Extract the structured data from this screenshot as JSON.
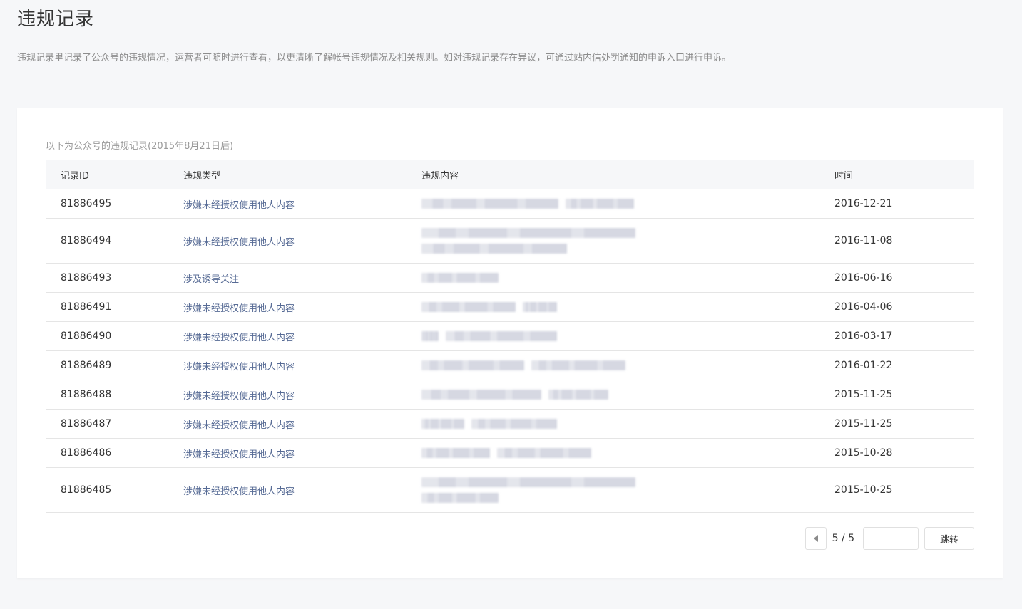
{
  "page": {
    "title": "违规记录",
    "description": "违规记录里记录了公众号的违规情况，运营者可随时进行查看，以更清晰了解帐号违规情况及相关规则。如对违规记录存在异议，可通过站内信处罚通知的申诉入口进行申诉。"
  },
  "card": {
    "caption": "以下为公众号的违规记录(2015年8月21日后)"
  },
  "table": {
    "headers": {
      "id": "记录ID",
      "type": "违规类型",
      "content": "违规内容",
      "time": "时间"
    },
    "rows": [
      {
        "id": "81886495",
        "type": "涉嫌未经授权使用他人内容",
        "time": "2016-12-21"
      },
      {
        "id": "81886494",
        "type": "涉嫌未经授权使用他人内容",
        "time": "2016-11-08"
      },
      {
        "id": "81886493",
        "type": "涉及诱导关注",
        "time": "2016-06-16"
      },
      {
        "id": "81886491",
        "type": "涉嫌未经授权使用他人内容",
        "time": "2016-04-06"
      },
      {
        "id": "81886490",
        "type": "涉嫌未经授权使用他人内容",
        "time": "2016-03-17"
      },
      {
        "id": "81886489",
        "type": "涉嫌未经授权使用他人内容",
        "time": "2016-01-22"
      },
      {
        "id": "81886488",
        "type": "涉嫌未经授权使用他人内容",
        "time": "2015-11-25"
      },
      {
        "id": "81886487",
        "type": "涉嫌未经授权使用他人内容",
        "time": "2015-11-25"
      },
      {
        "id": "81886486",
        "type": "涉嫌未经授权使用他人内容",
        "time": "2015-10-28"
      },
      {
        "id": "81886485",
        "type": "涉嫌未经授权使用他人内容",
        "time": "2015-10-25"
      }
    ]
  },
  "pagination": {
    "page_indicator": "5 / 5",
    "jump_input_value": "",
    "jump_label": "跳转",
    "prev_icon": "caret-left-icon"
  },
  "colors": {
    "background": "#f6f7f9",
    "card": "#ffffff",
    "link": "#576b95",
    "border": "#e5e5e5"
  }
}
